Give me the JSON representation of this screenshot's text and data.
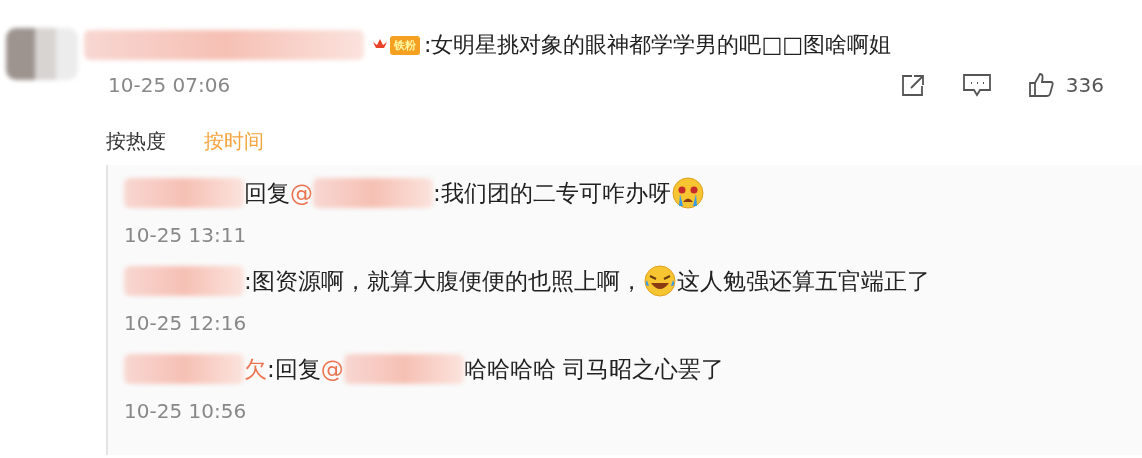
{
  "comment": {
    "badge": "铁粉",
    "text": ":女明星挑对象的眼神都学学男的吧□□图啥啊姐",
    "time": "10-25 07:06",
    "like_count": "336"
  },
  "sort_tabs": [
    {
      "label": "按热度",
      "selected": false
    },
    {
      "label": "按时间",
      "selected": true
    }
  ],
  "replies": [
    {
      "parts": [
        {
          "kind": "redacted"
        },
        {
          "kind": "text",
          "text": "回复"
        },
        {
          "kind": "mention",
          "text": "@"
        },
        {
          "kind": "redacted"
        },
        {
          "kind": "text",
          "text": ":我们团的二专可咋办呀"
        },
        {
          "kind": "crying-emoji"
        }
      ],
      "time": "10-25 13:11"
    },
    {
      "parts": [
        {
          "kind": "redacted"
        },
        {
          "kind": "text",
          "text": ":图资源啊，就算大腹便便的也照上啊，"
        },
        {
          "kind": "laughing-emoji"
        },
        {
          "kind": "text",
          "text": "这人勉强还算五官端正了"
        }
      ],
      "time": "10-25 12:16"
    },
    {
      "parts": [
        {
          "kind": "redacted"
        },
        {
          "kind": "mention",
          "text": "欠"
        },
        {
          "kind": "text",
          "text": ":回复"
        },
        {
          "kind": "mention",
          "text": "@"
        },
        {
          "kind": "redacted"
        },
        {
          "kind": "text",
          "text": "哈哈哈哈 司马昭之心罢了"
        }
      ],
      "time": "10-25 10:56"
    }
  ]
}
